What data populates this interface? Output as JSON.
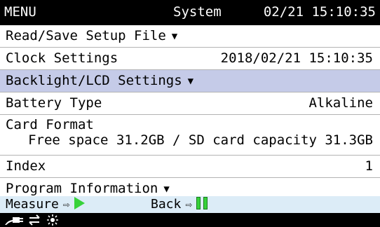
{
  "titlebar": {
    "menu_label": "MENU",
    "screen_title": "System",
    "datetime": "02/21 15:10:35"
  },
  "rows": [
    {
      "label": "Read/Save Setup File",
      "has_dropdown": true
    },
    {
      "label": "Clock Settings",
      "value": "2018/02/21 15:10:35"
    },
    {
      "label": "Backlight/LCD Settings",
      "has_dropdown": true,
      "selected": true
    },
    {
      "label": "Battery Type",
      "value": "Alkaline"
    },
    {
      "label": "Card Format",
      "sub_value": "Free space 31.2GB / SD card capacity 31.3GB"
    },
    {
      "label": "Index",
      "value": "1"
    },
    {
      "label": "Program Information",
      "has_dropdown": true
    }
  ],
  "dropdown_glyph": "▼",
  "guide": {
    "measure_label": "Measure",
    "back_label": "Back",
    "arrow_glyph": "⇨"
  },
  "status_icons": [
    "ac-power-icon",
    "transfer-icon",
    "backlight-icon"
  ],
  "colors": {
    "selected_row": "#c5cbe8",
    "guide_bar": "#dcecf7",
    "key_green": "#36d23a",
    "title_bar": "#000000"
  }
}
